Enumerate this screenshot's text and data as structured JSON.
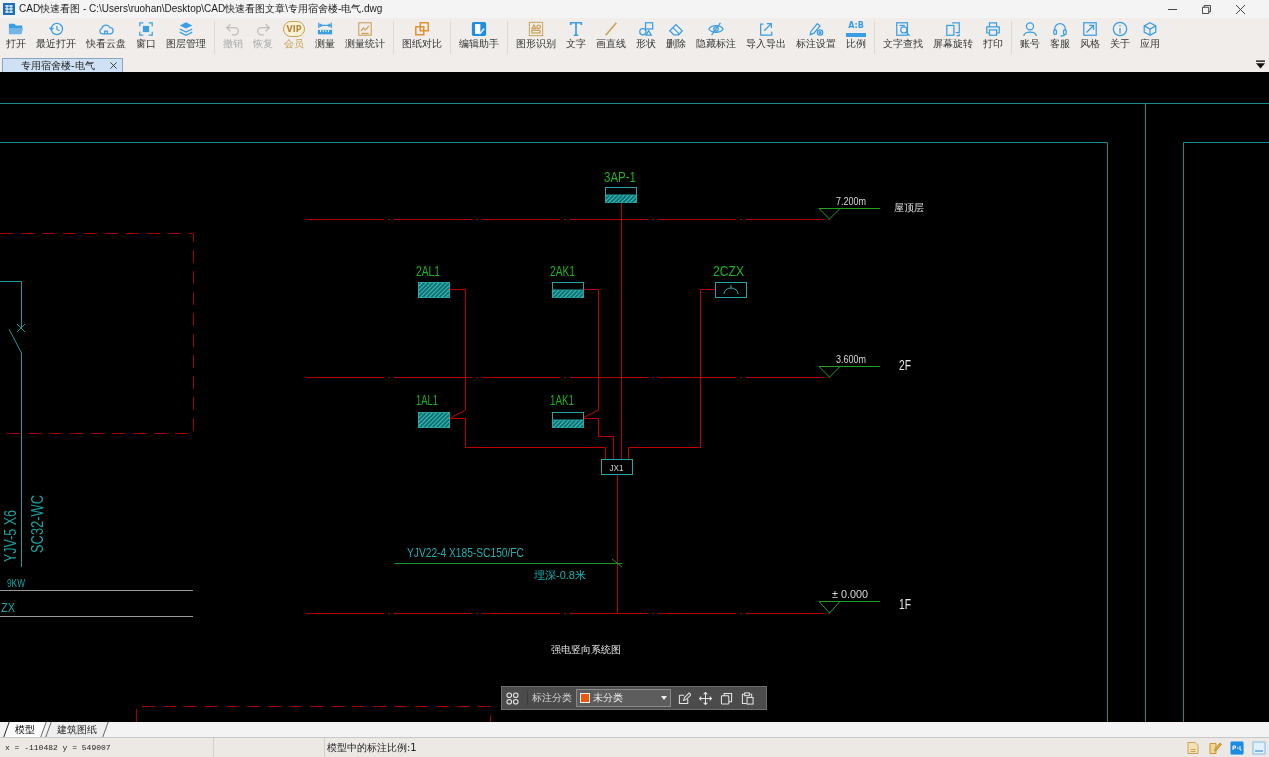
{
  "window": {
    "title": "CAD快速看图 - C:\\Users\\ruohan\\Desktop\\CAD快速看图文章\\专用宿舍楼-电气.dwg"
  },
  "toolbar": [
    {
      "items": [
        {
          "label": "打开",
          "kind": "tool",
          "disabled": false
        },
        {
          "label": "最近打开",
          "kind": "tool",
          "disabled": false
        },
        {
          "label": "快看云盘",
          "kind": "tool",
          "disabled": false
        },
        {
          "label": "窗口",
          "kind": "tool",
          "disabled": false
        },
        {
          "label": "图层管理",
          "kind": "tool",
          "disabled": false
        }
      ]
    },
    {
      "items": [
        {
          "label": "撤销",
          "kind": "tool",
          "disabled": true
        },
        {
          "label": "恢复",
          "kind": "tool",
          "disabled": true
        },
        {
          "label": "会员",
          "kind": "vip",
          "disabled": false,
          "icon_text": "VIP"
        },
        {
          "label": "测量",
          "kind": "tool",
          "disabled": false
        },
        {
          "label": "测量统计",
          "kind": "tool",
          "disabled": false
        }
      ]
    },
    {
      "items": [
        {
          "label": "图纸对比",
          "kind": "tool",
          "disabled": false
        }
      ]
    },
    {
      "items": [
        {
          "label": "编辑助手",
          "kind": "tool",
          "disabled": false
        }
      ]
    },
    {
      "items": [
        {
          "label": "图形识别",
          "kind": "tool",
          "disabled": false
        },
        {
          "label": "文字",
          "kind": "tool",
          "disabled": false
        },
        {
          "label": "画直线",
          "kind": "tool",
          "disabled": false
        },
        {
          "label": "形状",
          "kind": "tool",
          "disabled": false
        },
        {
          "label": "删除",
          "kind": "tool",
          "disabled": false
        },
        {
          "label": "隐藏标注",
          "kind": "tool",
          "disabled": false
        },
        {
          "label": "导入导出",
          "kind": "tool",
          "disabled": false
        },
        {
          "label": "标注设置",
          "kind": "tool",
          "disabled": false
        },
        {
          "label": "比例",
          "kind": "tool",
          "disabled": false,
          "icon_text": "A:B"
        }
      ]
    },
    {
      "items": [
        {
          "label": "文字查找",
          "kind": "tool",
          "disabled": false
        },
        {
          "label": "屏幕旋转",
          "kind": "tool",
          "disabled": false
        },
        {
          "label": "打印",
          "kind": "tool",
          "disabled": false
        }
      ]
    },
    {
      "items": [
        {
          "label": "账号",
          "kind": "tool",
          "disabled": false
        },
        {
          "label": "客服",
          "kind": "tool",
          "disabled": false
        },
        {
          "label": "风格",
          "kind": "tool",
          "disabled": false
        },
        {
          "label": "关于",
          "kind": "tool",
          "disabled": false
        },
        {
          "label": "应用",
          "kind": "tool",
          "disabled": false
        }
      ]
    }
  ],
  "document_tabs": [
    {
      "label": "专用宿舍楼-电气",
      "selected": true
    }
  ],
  "drawing": {
    "left_circuit": {
      "cable": "YJV-5 X6",
      "conduit": "SC32-WC",
      "load": "9KW",
      "panel": "ZX"
    },
    "panels": [
      {
        "label": "3AP-1",
        "kind": "half_hatched"
      },
      {
        "label": "2AL1",
        "kind": "hatched"
      },
      {
        "label": "2AK1",
        "kind": "half_hatched"
      },
      {
        "label": "2CZX",
        "kind": "socket"
      },
      {
        "label": "1AL1",
        "kind": "hatched"
      },
      {
        "label": "1AK1",
        "kind": "half_hatched"
      }
    ],
    "levels": [
      {
        "elevation": "7.200m",
        "floor": "屋顶层"
      },
      {
        "elevation": "3.600m",
        "floor": "2F"
      },
      {
        "elevation": "± 0.000",
        "floor": "1F"
      }
    ],
    "junction": "JX1",
    "incoming_cable": "YJV22-4 X185-SC150/FC",
    "burial_depth": "埋深-0.8米",
    "title": "强电竖向系统图"
  },
  "annotation_bar": {
    "label": "标注分类",
    "category": "未分类"
  },
  "sheet_tabs": [
    {
      "label": "模型",
      "selected": true
    },
    {
      "label": "建筑图纸",
      "selected": false
    }
  ],
  "status_bar": {
    "coordinates": "x = -110482 y = 549007",
    "scale": "模型中的标注比例:1"
  }
}
